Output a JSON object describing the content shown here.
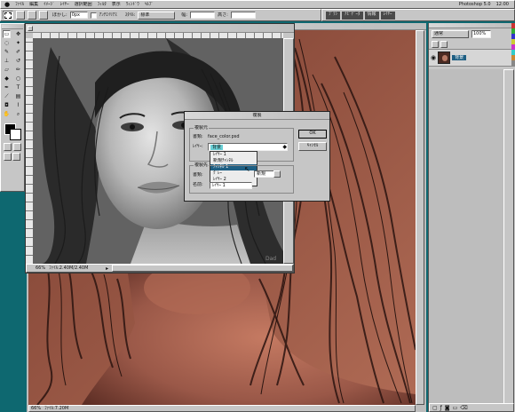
{
  "app": {
    "title": "",
    "menubar": {
      "items": [
        "ﾌｧｲﾙ",
        "編集",
        "ｲﾒｰｼﾞ",
        "ﾚｲﾔｰ",
        "選択範囲",
        "ﾌｨﾙﾀ",
        "表示",
        "ｳｨﾝﾄﾞｳ",
        "ﾍﾙﾌﾟ"
      ],
      "right_text": "Photoshop 5.0",
      "clock": "12:00"
    }
  },
  "options_bar": {
    "feather_label": "ぼかし:",
    "feather_value": "0px",
    "antialias_label": "ｱﾝﾁｴｲﾘｱｽ",
    "style_label": "ｽﾀｲﾙ:",
    "style_value": "標準",
    "width_label": "幅:",
    "height_label": "高さ:"
  },
  "palette_strip": {
    "tabs": [
      "ﾌﾞﾗｼ",
      "ﾅﾋﾞｹﾞｰﾀ",
      "情報",
      "ﾚｲﾔｰ"
    ]
  },
  "gray_window": {
    "zoom": "66%",
    "status": "ﾌｧｲﾙ:2.40M/2.40M"
  },
  "main_canvas": {
    "zoom": "66%",
    "status": "ﾌｧｲﾙ:7.20M"
  },
  "dialog": {
    "title": "複製",
    "group_source": "複製元",
    "doc_label": "書類:",
    "doc_value": "face_color.psd",
    "layer_label": "ﾚｲﾔｰ:",
    "layer_value": "背景",
    "dropdown_items": [
      "ﾚｲﾔｰ 1",
      "新規ﾁｬﾝﾈﾙ",
      "ﾁｬﾝﾈﾙ 1",
      "ｸﾞﾚｰ",
      "ﾚｲﾔｰ 2"
    ],
    "selected_index": 2,
    "group_dest": "複製先",
    "dest_label": "書類:",
    "dest_value": "新規",
    "name_label": "名前:",
    "name_value": "ﾚｲﾔｰ 1",
    "ok_label": "OK",
    "cancel_label": "ｷｬﾝｾﾙ"
  },
  "layers_panel": {
    "mode_value": "通常",
    "opacity_value": "100%",
    "layer_name": "背景"
  },
  "colors": {
    "desktop": "#0e6870",
    "dialog_highlight": "#1e5f83",
    "skin": "#9a5848",
    "gray_bg": "#636363"
  }
}
